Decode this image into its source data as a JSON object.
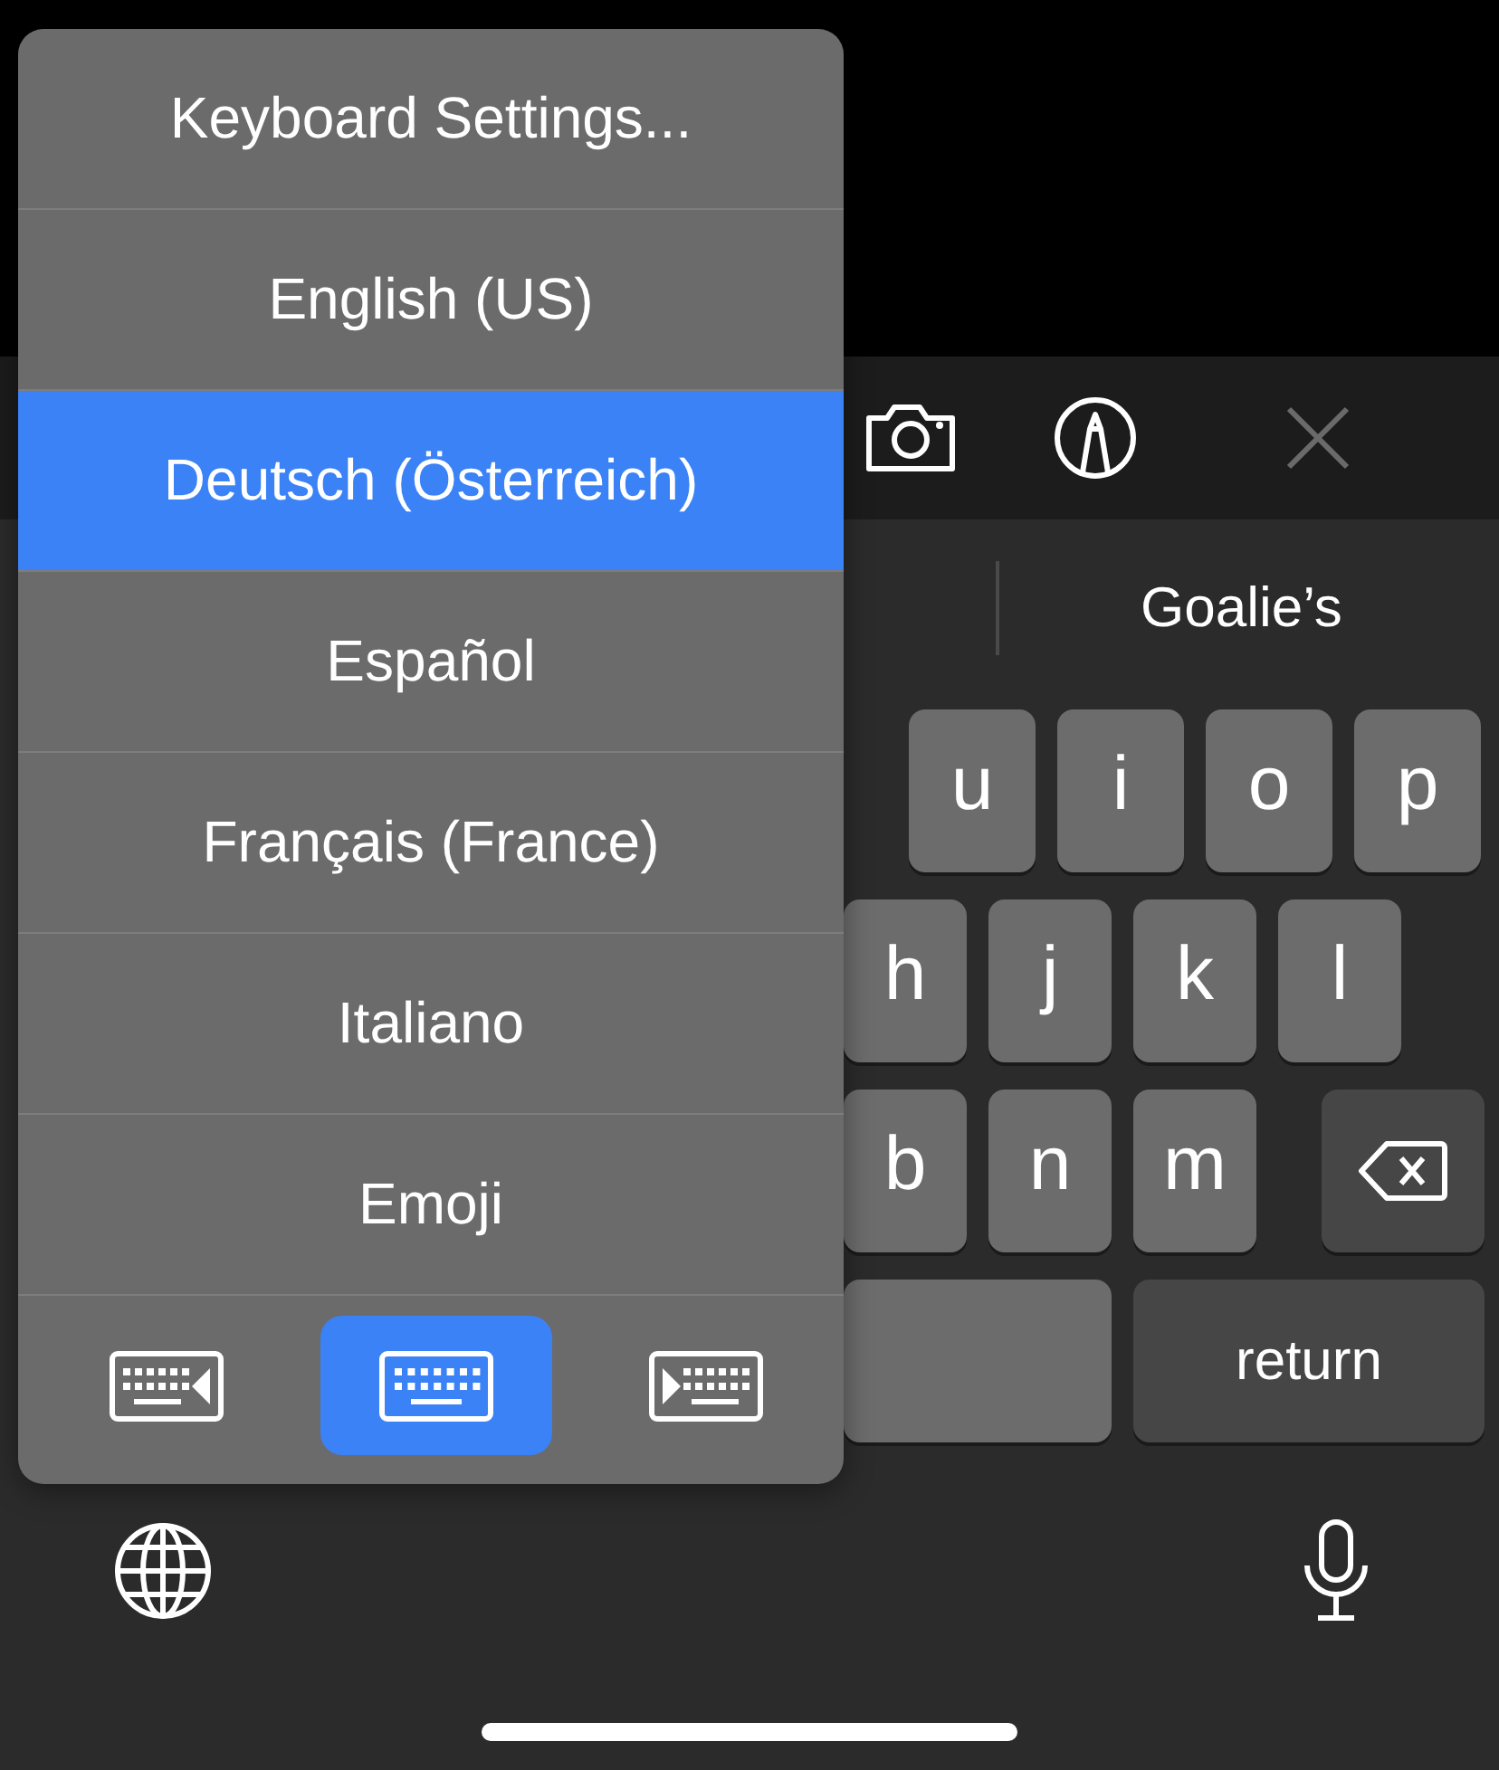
{
  "toolbar": {
    "close_disabled": true
  },
  "suggestions": [
    "Goalie’s"
  ],
  "keyboard": {
    "rows": [
      [
        {
          "kind": "letter",
          "label": "u"
        },
        {
          "kind": "letter",
          "label": "i"
        },
        {
          "kind": "letter",
          "label": "o"
        },
        {
          "kind": "letter",
          "label": "p"
        }
      ],
      [
        {
          "kind": "letter",
          "label": "h"
        },
        {
          "kind": "letter",
          "label": "j"
        },
        {
          "kind": "letter",
          "label": "k"
        },
        {
          "kind": "letter",
          "label": "l"
        }
      ],
      [
        {
          "kind": "letter",
          "label": "b"
        },
        {
          "kind": "letter",
          "label": "n"
        },
        {
          "kind": "letter",
          "label": "m"
        },
        {
          "kind": "delete"
        }
      ],
      [
        {
          "kind": "space"
        },
        {
          "kind": "return",
          "label": "return"
        }
      ]
    ]
  },
  "menu": {
    "items": [
      {
        "label": "Keyboard Settings...",
        "selected": false
      },
      {
        "label": "English (US)",
        "selected": false
      },
      {
        "label": "Deutsch (Österreich)",
        "selected": true
      },
      {
        "label": "Español",
        "selected": false
      },
      {
        "label": "Français (France)",
        "selected": false
      },
      {
        "label": "Italiano",
        "selected": false
      },
      {
        "label": "Emoji",
        "selected": false
      }
    ],
    "layouts": [
      {
        "kind": "left",
        "selected": false
      },
      {
        "kind": "full",
        "selected": true
      },
      {
        "kind": "right",
        "selected": false
      }
    ]
  }
}
